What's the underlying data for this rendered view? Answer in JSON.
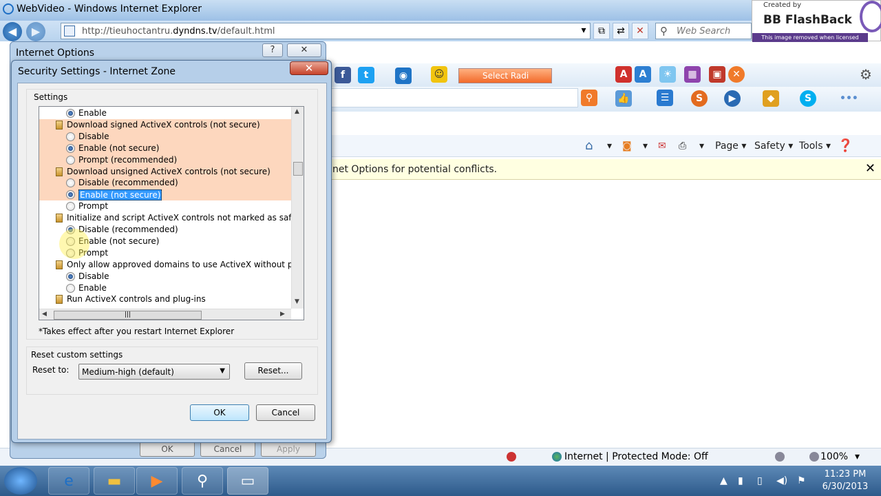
{
  "browser": {
    "title": "WebVideo - Windows Internet Explorer",
    "url_prefix": "http://tieuhoctantru.",
    "url_domain": "dyndns.tv",
    "url_suffix": "/default.html",
    "search_placeholder": "Web Search",
    "toolbar": {
      "select_radio": "Select Radi"
    },
    "commands": {
      "page": "Page ▾",
      "safety": "Safety ▾",
      "tools": "Tools ▾"
    },
    "infobar_message": "net Options for potential conflicts.",
    "status_zone": "Internet | Protected Mode: Off",
    "status_zoom": "100%"
  },
  "watermark": {
    "created_by": "Created by",
    "product": "BB FlashBack",
    "notice": "This image removed when licensed"
  },
  "internet_options": {
    "title": "Internet Options",
    "help_glyph": "?",
    "close_glyph": "✕",
    "ok_label": "OK",
    "cancel_label": "Cancel",
    "apply_label": "Apply"
  },
  "security_dialog": {
    "title": "Security Settings - Internet Zone",
    "close_glyph": "✕",
    "settings_label": "Settings",
    "rows": [
      {
        "kind": "option",
        "label": "Enable",
        "checked": true,
        "hl": false
      },
      {
        "kind": "header",
        "label": "Download signed ActiveX controls (not secure)",
        "hl": true
      },
      {
        "kind": "option",
        "label": "Disable",
        "checked": false,
        "hl": true
      },
      {
        "kind": "option",
        "label": "Enable (not secure)",
        "checked": true,
        "hl": true
      },
      {
        "kind": "option",
        "label": "Prompt (recommended)",
        "checked": false,
        "hl": true
      },
      {
        "kind": "header",
        "label": "Download unsigned ActiveX controls (not secure)",
        "hl": true
      },
      {
        "kind": "option",
        "label": "Disable (recommended)",
        "checked": false,
        "hl": true
      },
      {
        "kind": "option",
        "label": "Enable (not secure)",
        "checked": true,
        "hl": true,
        "selected": true
      },
      {
        "kind": "option",
        "label": "Prompt",
        "checked": false,
        "hl": false
      },
      {
        "kind": "header",
        "label": "Initialize and script ActiveX controls not marked as safe for s",
        "hl": false
      },
      {
        "kind": "option",
        "label": "Disable (recommended)",
        "checked": true,
        "hl": false
      },
      {
        "kind": "option",
        "label": "Enable (not secure)",
        "checked": false,
        "hl": false
      },
      {
        "kind": "option",
        "label": "Prompt",
        "checked": false,
        "hl": false
      },
      {
        "kind": "header",
        "label": "Only allow approved domains to use ActiveX without prompt",
        "hl": false
      },
      {
        "kind": "option",
        "label": "Disable",
        "checked": true,
        "hl": false
      },
      {
        "kind": "option",
        "label": "Enable",
        "checked": false,
        "hl": false
      },
      {
        "kind": "header",
        "label": "Run ActiveX controls and plug-ins",
        "hl": false
      }
    ],
    "restart_note": "*Takes effect after you restart Internet Explorer",
    "reset_group_label": "Reset custom settings",
    "reset_to_label": "Reset to:",
    "reset_level": "Medium-high (default)",
    "reset_button": "Reset...",
    "ok_label": "OK",
    "cancel_label": "Cancel"
  },
  "taskbar": {
    "time": "11:23 PM",
    "date": "6/30/2013"
  }
}
